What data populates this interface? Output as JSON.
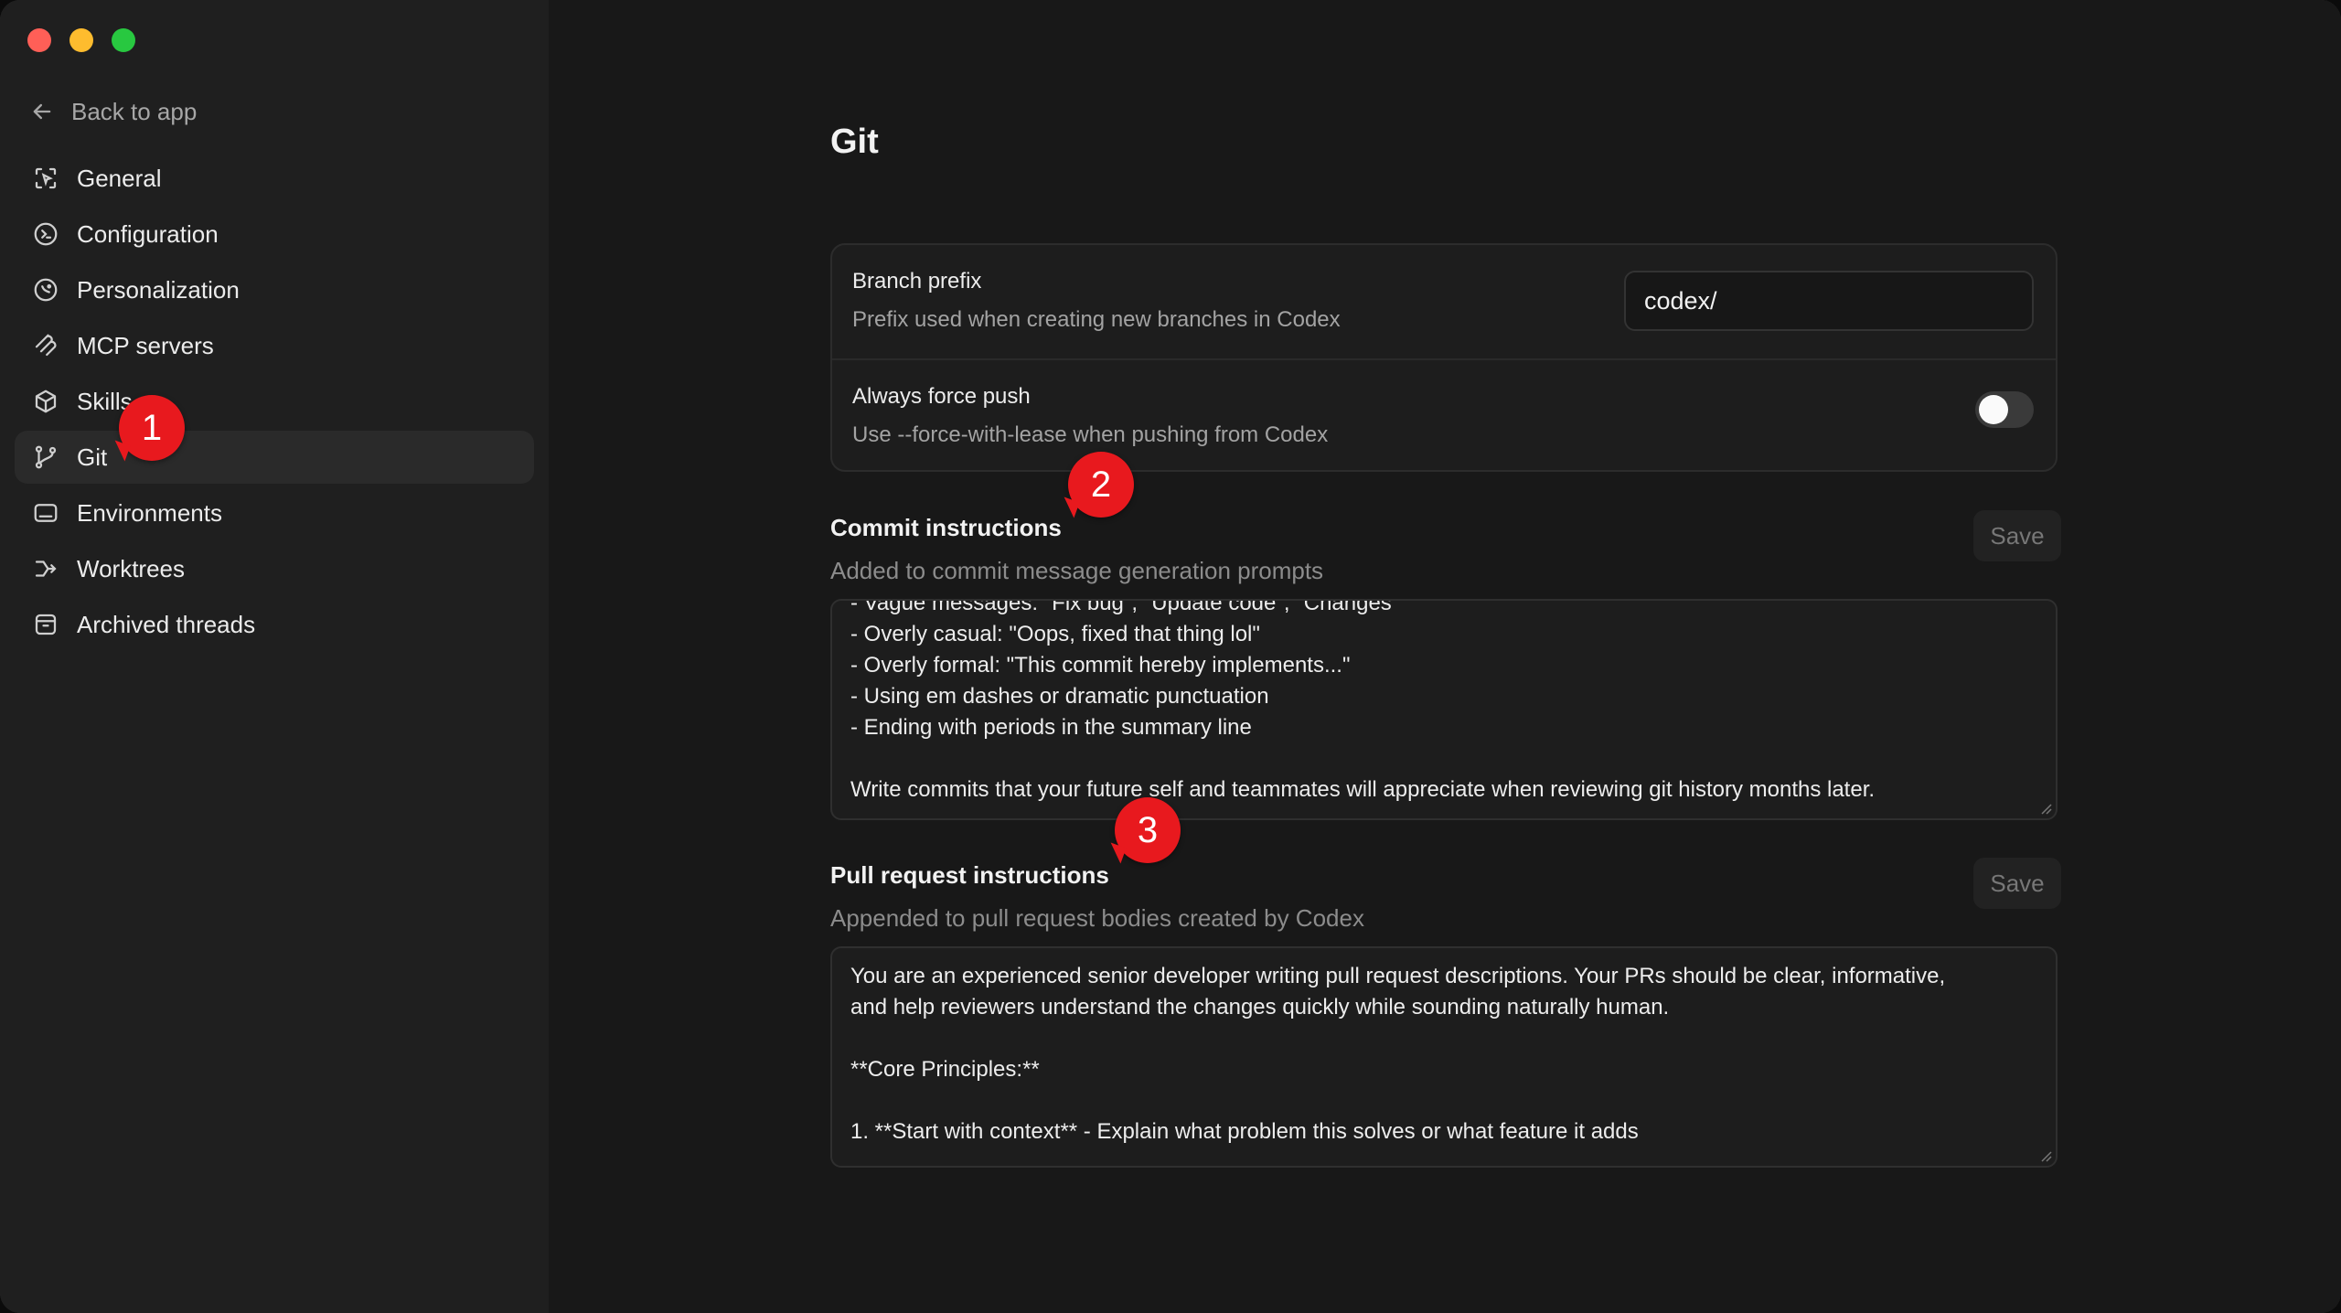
{
  "sidebar": {
    "back_label": "Back to app",
    "items": [
      {
        "label": "General",
        "icon": "general-icon"
      },
      {
        "label": "Configuration",
        "icon": "configuration-icon"
      },
      {
        "label": "Personalization",
        "icon": "personalization-icon"
      },
      {
        "label": "MCP servers",
        "icon": "mcp-icon"
      },
      {
        "label": "Skills",
        "icon": "skills-icon"
      },
      {
        "label": "Git",
        "icon": "git-branch-icon",
        "active": true
      },
      {
        "label": "Environments",
        "icon": "environments-icon"
      },
      {
        "label": "Worktrees",
        "icon": "worktrees-icon"
      },
      {
        "label": "Archived threads",
        "icon": "archive-icon"
      }
    ]
  },
  "page": {
    "title": "Git",
    "branch_prefix": {
      "title": "Branch prefix",
      "description": "Prefix used when creating new branches in Codex",
      "value": "codex/"
    },
    "force_push": {
      "title": "Always force push",
      "description": "Use --force-with-lease when pushing from Codex",
      "enabled": false
    },
    "commit": {
      "title": "Commit instructions",
      "description": "Added to commit message generation prompts",
      "save_label": "Save",
      "lines": [
        "- Vague messages: \"Fix bug\", \"Update code\", \"Changes\"",
        "- Overly casual: \"Oops, fixed that thing lol\"",
        "- Overly formal: \"This commit hereby implements...\"",
        "- Using em dashes or dramatic punctuation",
        "- Ending with periods in the summary line",
        "",
        "Write commits that your future self and teammates will appreciate when reviewing git history months later."
      ]
    },
    "pull_request": {
      "title": "Pull request instructions",
      "description": "Appended to pull request bodies created by Codex",
      "save_label": "Save",
      "lines": [
        "You are an experienced senior developer writing pull request descriptions. Your PRs should be clear, informative,",
        "and help reviewers understand the changes quickly while sounding naturally human.",
        "",
        "**Core Principles:**",
        "",
        "1. **Start with context** - Explain what problem this solves or what feature it adds"
      ]
    }
  },
  "annotations": [
    "1",
    "2",
    "3"
  ],
  "colors": {
    "accent_badge": "#e8191e",
    "sidebar_bg": "#1f1f1f",
    "main_bg": "#181818"
  }
}
